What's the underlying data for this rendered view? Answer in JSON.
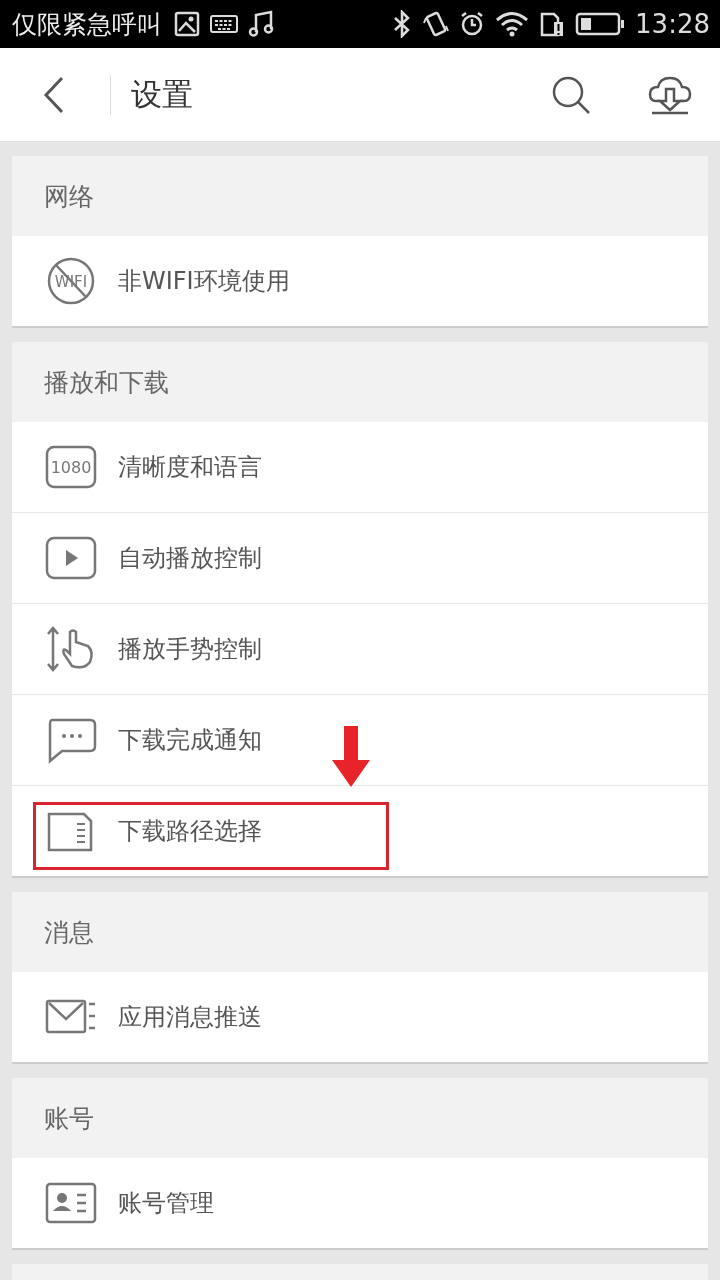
{
  "status_bar": {
    "carrier": "仅限紧急呼叫",
    "time": "13:28"
  },
  "header": {
    "title": "设置"
  },
  "sections": [
    {
      "title": "网络",
      "items": [
        {
          "kind": "wifi-off",
          "icon_text": "WIFI",
          "label": "非WIFI环境使用",
          "highlighted": false
        }
      ]
    },
    {
      "title": "播放和下载",
      "items": [
        {
          "kind": "resolution",
          "icon_text": "1080",
          "label": "清晰度和语言",
          "highlighted": false
        },
        {
          "kind": "play",
          "label": "自动播放控制",
          "highlighted": false
        },
        {
          "kind": "gesture",
          "label": "播放手势控制",
          "highlighted": false
        },
        {
          "kind": "message",
          "label": "下载完成通知",
          "highlighted": false
        },
        {
          "kind": "storage",
          "label": "下载路径选择",
          "highlighted": true
        }
      ]
    },
    {
      "title": "消息",
      "items": [
        {
          "kind": "mail",
          "label": "应用消息推送",
          "highlighted": false
        }
      ]
    },
    {
      "title": "账号",
      "items": [
        {
          "kind": "id-card",
          "label": "账号管理",
          "highlighted": false
        }
      ]
    }
  ]
}
